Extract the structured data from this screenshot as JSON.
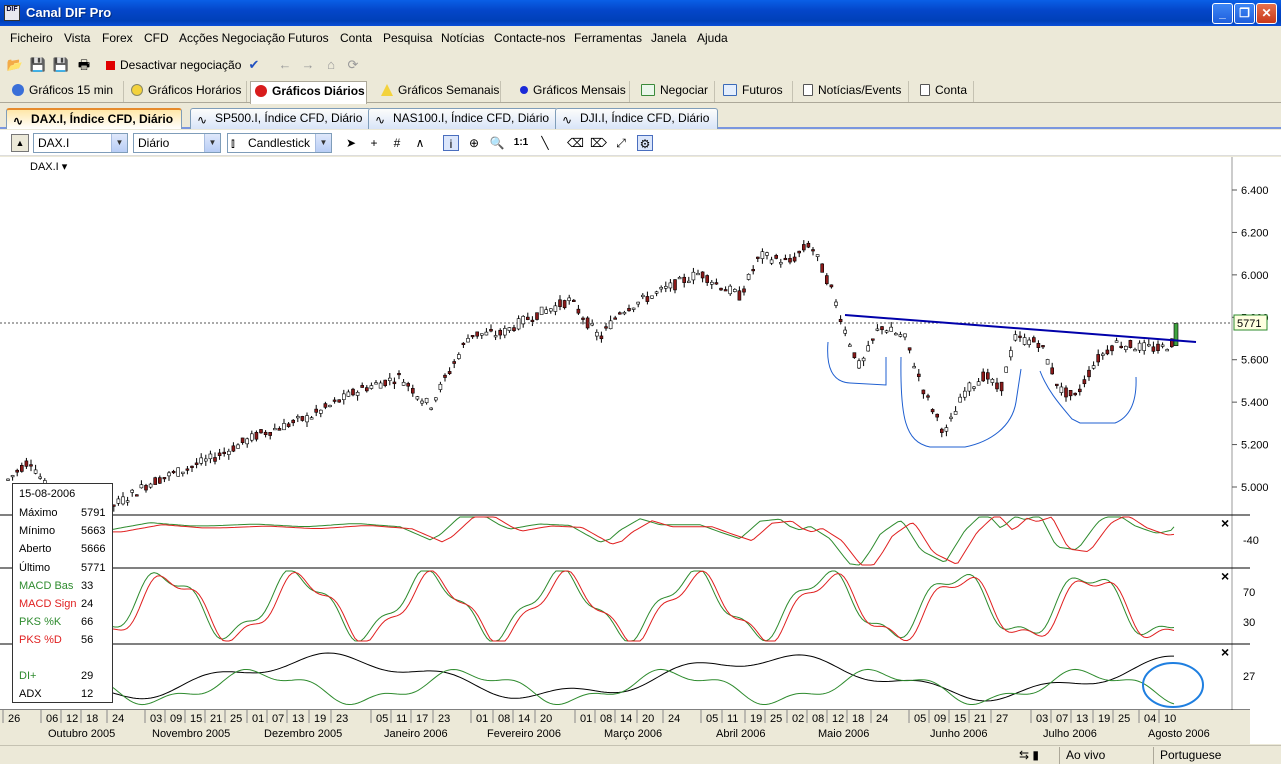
{
  "window": {
    "title": "Canal DIF Pro"
  },
  "menu": [
    "Ficheiro",
    "Vista",
    "Forex",
    "CFD",
    "Acções Negociação",
    "Futuros",
    "Conta",
    "Pesquisa",
    "Notícias",
    "Contacte-nos",
    "Ferramentas",
    "Janela",
    "Ajuda"
  ],
  "toolbar": {
    "deactivate_label": "Desactivar negociação"
  },
  "main_tabs": [
    "Gráficos 15 min",
    "Gráficos Horários",
    "Gráficos Diários",
    "Gráficos Semanais",
    "Gráficos Mensais",
    "Negociar",
    "Futuros",
    "Notícias/Events",
    "Conta"
  ],
  "chart_tabs": [
    "DAX.I, Índice CFD, Diário",
    "SP500.I, Índice CFD, Diário",
    "NAS100.I, Índice CFD, Diário",
    "DJI.I, Índice CFD, Diário"
  ],
  "controls": {
    "symbol": "DAX.I",
    "period": "Diário",
    "chart_type": "Candlestick"
  },
  "chart_label": "DAX.I",
  "price_tag": "5771",
  "data_box": {
    "date": "15-08-2006",
    "rows": [
      {
        "label": "Máximo",
        "value": "5791",
        "color": "#000000"
      },
      {
        "label": "Mínimo",
        "value": "5663",
        "color": "#000000"
      },
      {
        "label": "Aberto",
        "value": "5666",
        "color": "#000000"
      },
      {
        "label": "Último",
        "value": "5771",
        "color": "#000000"
      },
      {
        "label": "MACD Bas",
        "value": "33",
        "color": "#2e8b2e"
      },
      {
        "label": "MACD Sign",
        "value": "24",
        "color": "#e02020"
      },
      {
        "label": "PKS %K",
        "value": "66",
        "color": "#2e8b2e"
      },
      {
        "label": "PKS %D",
        "value": "56",
        "color": "#e02020"
      },
      {
        "label": "DI+",
        "value": "29",
        "color": "#2e8b2e"
      },
      {
        "label": "ADX",
        "value": "12",
        "color": "#000000"
      }
    ]
  },
  "status": {
    "mode": "Ao vivo",
    "language": "Portuguese"
  },
  "chart_data": {
    "type": "candlestick",
    "y_ticks": [
      "6.400",
      "6.200",
      "6.000",
      "5.800",
      "5.600",
      "5.400",
      "5.200",
      "5.000"
    ],
    "ylim": [
      4900,
      6450
    ],
    "macd_ticks": [
      "-40"
    ],
    "stoch_ticks": [
      "70",
      "30"
    ],
    "adx_ticks": [
      "27"
    ],
    "x_day_labels": [
      "26",
      "06",
      "12",
      "18",
      "24",
      "03",
      "09",
      "15",
      "21",
      "25",
      "01",
      "07",
      "13",
      "19",
      "23",
      "05",
      "11",
      "17",
      "23",
      "01",
      "08",
      "14",
      "20",
      "01",
      "08",
      "14",
      "20",
      "24",
      "05",
      "11",
      "19",
      "25",
      "02",
      "08",
      "12",
      "18",
      "24",
      "05",
      "09",
      "15",
      "21",
      "27",
      "03",
      "07",
      "13",
      "19",
      "25",
      "04",
      "10"
    ],
    "x_month_labels": [
      "Outubro 2005",
      "Novembro 2005",
      "Dezembro 2005",
      "Janeiro 2006",
      "Fevereiro 2006",
      "Março 2006",
      "Abril 2006",
      "Maio 2006",
      "Junho 2006",
      "Julho 2006",
      "Agosto 2006"
    ],
    "last_close": 5771
  }
}
